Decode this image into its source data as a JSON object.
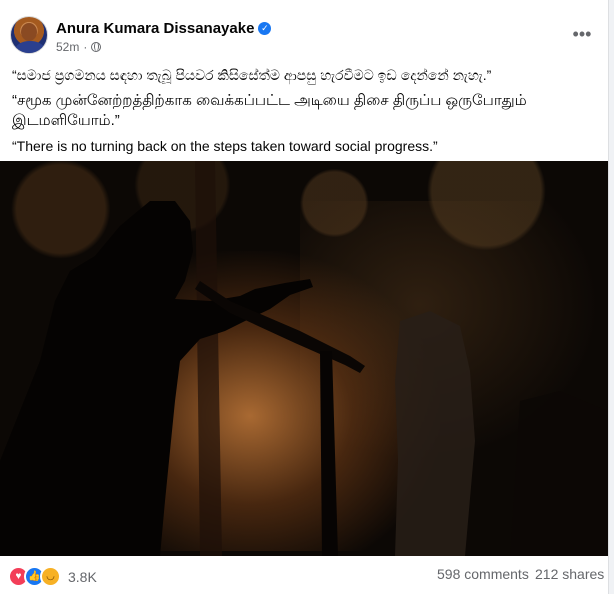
{
  "post": {
    "author": "Anura Kumara Dissanayake",
    "timestamp": "52m",
    "privacy_icon": "globe-icon",
    "verified_icon": "verified-badge-icon",
    "more_icon": "more-options-icon",
    "text_lines": [
      "“සමාජ ප්‍රගමනය සඳහා තැබූ පියවර කිසිසේත්ම ආපසු හැරවීමට ඉඩ දෙන්නේ නැහැ.”",
      "“சமூக முன்னேற்றத்திற்காக வைக்கப்பட்ட அடியை திசை திருப்ப ஒருபோதும் இடமளியோம்.”",
      "“There is no turning back on the steps taken toward social progress.”"
    ]
  },
  "stats": {
    "reaction_icons": [
      "love-reaction-icon",
      "like-reaction-icon",
      "haha-reaction-icon"
    ],
    "reaction_count": "3.8K",
    "comments": "598 comments",
    "shares": "212 shares"
  },
  "colors": {
    "accent": "#1877f2",
    "secondary_text": "#65676b"
  }
}
